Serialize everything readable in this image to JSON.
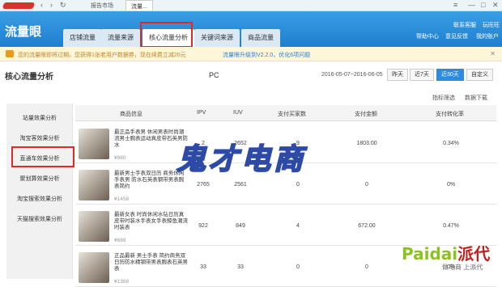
{
  "topbar": {
    "crumb1": "报告市场",
    "crumb2": "流量..."
  },
  "header": {
    "logo": "流量眼",
    "tabs": [
      "店铺流量",
      "流量来源",
      "核心流量分析",
      "关键词来源",
      "商品流量"
    ],
    "right1": "联系客服",
    "right2": "玩旺旺",
    "right3": "帮助中心",
    "right4": "意见反馈",
    "right5": "我的账户"
  },
  "notice": {
    "text": "您的流量眼即将过期，您获得1张老用户数据券，现在续费立减20元",
    "update": "流量眼升级到V2.2.0，优化6项问题"
  },
  "page": {
    "title": "核心流量分析",
    "device": "PC",
    "date_range": "2016-05-07~2016-06-05",
    "btns": [
      "昨天",
      "近7天",
      "近30天",
      "自定义"
    ]
  },
  "tools": {
    "filter": "指标筛选",
    "download": "数据下载"
  },
  "sidebar": {
    "items": [
      "站量效果分析",
      "淘宝客效果分析",
      "直通车效果分析",
      "聚划算效果分析",
      "淘宝搜索效果分析",
      "天猫搜索效果分析"
    ]
  },
  "table": {
    "headers": [
      "商品信息",
      "IPV",
      "IUV",
      "支付买家数",
      "支付金额",
      "支付转化率"
    ],
    "rows": [
      {
        "name": "最正品手表男 休闲男表时尚潮流男士腕表运动真皮带石英男防水",
        "price": "¥980",
        "ipv": "2",
        "iuv": "2652",
        "buyers": "9",
        "amount": "1803.00",
        "rate": "0.34%"
      },
      {
        "name": "最新男士手表双日历 商务休闲手表男 防水石英表钢带男表腕表简约",
        "price": "¥1458",
        "ipv": "2765",
        "iuv": "2561",
        "buyers": "0",
        "amount": "0",
        "rate": "0%"
      },
      {
        "name": "最新女表 时尚休闲水钻日历真皮带时装水手表女手表鲸鱼潮流时装表",
        "price": "¥688",
        "ipv": "922",
        "iuv": "849",
        "buyers": "4",
        "amount": "672.00",
        "rate": "0.47%"
      },
      {
        "name": "正品最新 男士手表 简约商务双日历防水精钢带男表腕表石英男表",
        "price": "¥1368",
        "ipv": "33",
        "iuv": "33",
        "buyers": "0",
        "amount": "0",
        "rate": "0%"
      }
    ]
  },
  "watermark": {
    "main": "鬼才电商",
    "brand": "Paidai",
    "brand2": "派代",
    "slogan": "做电商 上派代"
  }
}
